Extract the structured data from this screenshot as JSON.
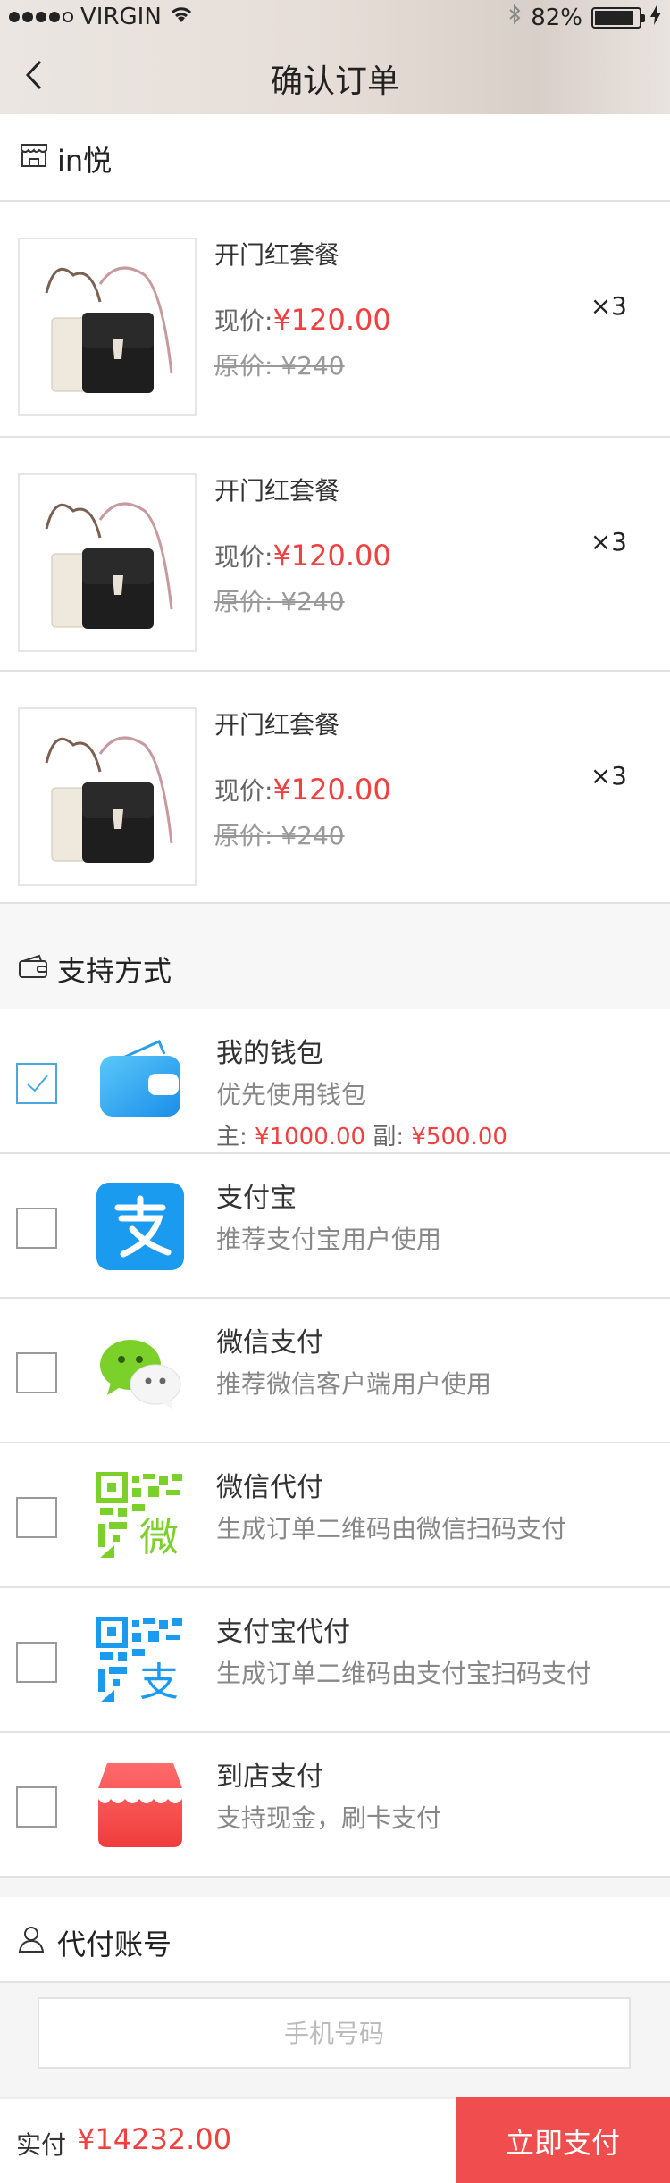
{
  "status_bar": {
    "carrier": "VIRGIN",
    "battery": "82%"
  },
  "nav": {
    "title": "确认订单"
  },
  "shop": {
    "name": "in悦"
  },
  "products": [
    {
      "name": "开门红套餐",
      "price_label": "现价:",
      "price": "¥120.00",
      "orig_label": "原价:",
      "orig": "¥240",
      "qty": "×3"
    },
    {
      "name": "开门红套餐",
      "price_label": "现价:",
      "price": "¥120.00",
      "orig_label": "原价:",
      "orig": "¥240",
      "qty": "×3"
    },
    {
      "name": "开门红套餐",
      "price_label": "现价:",
      "price": "¥120.00",
      "orig_label": "原价:",
      "orig": "¥240",
      "qty": "×3"
    }
  ],
  "payment": {
    "header": "支持方式",
    "options": [
      {
        "title": "我的钱包",
        "subtitle": "优先使用钱包",
        "checked": true,
        "balance": {
          "main_label": "主:",
          "main": "¥1000.00",
          "sub_label": "副:",
          "sub": "¥500.00"
        }
      },
      {
        "title": "支付宝",
        "subtitle": "推荐支付宝用户使用",
        "checked": false
      },
      {
        "title": "微信支付",
        "subtitle": "推荐微信客户端用户使用",
        "checked": false
      },
      {
        "title": "微信代付",
        "subtitle": "生成订单二维码由微信扫码支付",
        "checked": false
      },
      {
        "title": "支付宝代付",
        "subtitle": "生成订单二维码由支付宝扫码支付",
        "checked": false
      },
      {
        "title": "到店支付",
        "subtitle": "支持现金，刷卡支付",
        "checked": false
      }
    ]
  },
  "proxy": {
    "header": "代付账号",
    "phone_placeholder": "手机号码"
  },
  "footer": {
    "total_label": "实付",
    "total": "¥14232.00",
    "pay_button": "立即支付"
  },
  "colors": {
    "price_red": "#f04040",
    "pay_button": "#f04e4e",
    "check_blue": "#4aa8e0",
    "alipay_blue": "#1a9bf0",
    "wechat_green": "#7bd12a"
  }
}
